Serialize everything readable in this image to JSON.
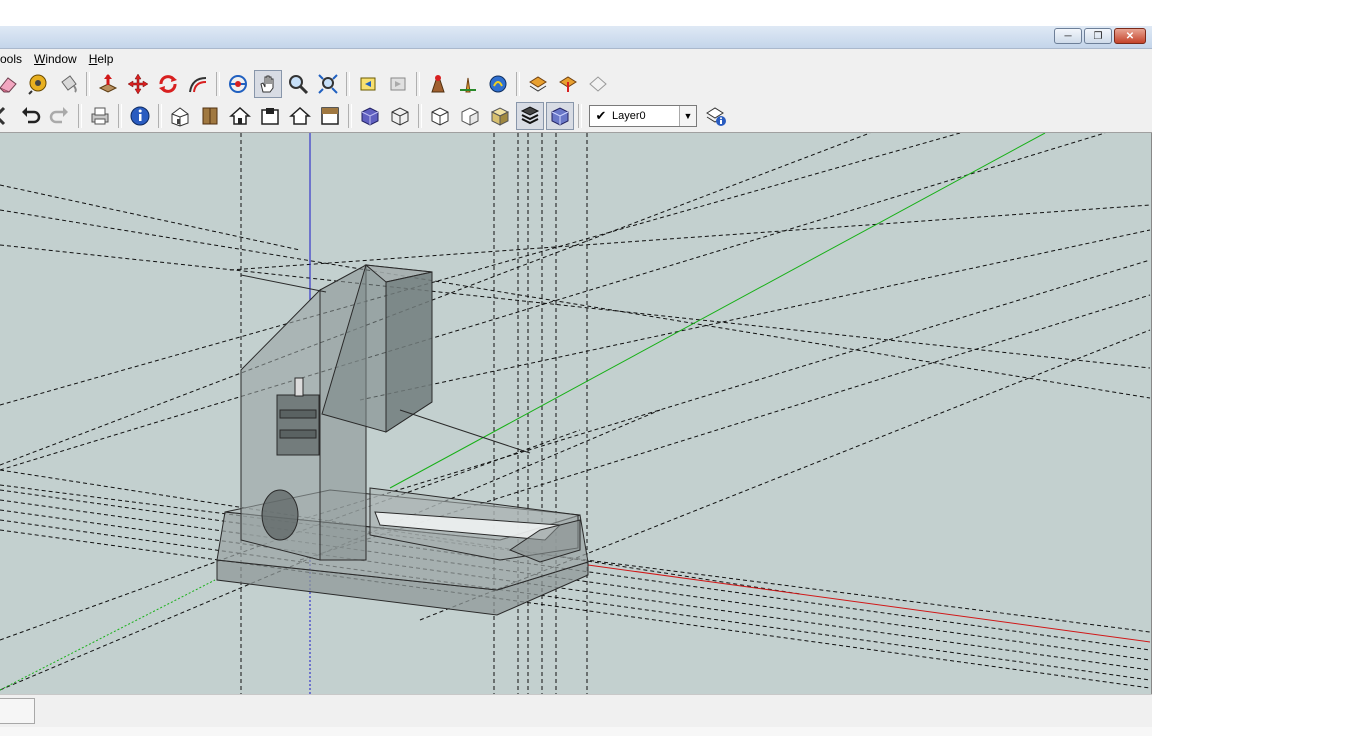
{
  "menu": {
    "items": [
      "Tools",
      "Window",
      "Help"
    ],
    "visible_text": [
      "ools",
      "Window",
      "Help"
    ],
    "mnemonics": [
      "T",
      "W",
      "H"
    ]
  },
  "window_controls": {
    "minimize": "minimize-icon",
    "restore": "restore-icon",
    "close": "close-icon"
  },
  "toolbar_row1": {
    "tools": [
      "eraser",
      "tape-measure",
      "paint-bucket",
      "push-pull",
      "move",
      "rotate",
      "follow-me",
      "orbit",
      "pan",
      "zoom",
      "zoom-extents",
      "previous-view",
      "next-view",
      "position-camera",
      "look-around",
      "walk",
      "section-plane",
      "section-display",
      "section-cut"
    ]
  },
  "toolbar_row2": {
    "tools": [
      "back",
      "undo",
      "redo",
      "print",
      "model-info",
      "iso-view",
      "top-view",
      "front-view",
      "right-view",
      "back-view",
      "left-view",
      "xray",
      "wireframe",
      "hidden-line",
      "shaded",
      "shaded-textures",
      "monochrome"
    ],
    "pressed": [
      "shaded-textures",
      "monochrome"
    ]
  },
  "layer": {
    "current": "Layer0",
    "checked": true
  },
  "colors": {
    "viewport_bg": "#c3d0cf",
    "axis_red": "#d01818",
    "axis_green": "#18b018",
    "axis_blue": "#1818c8"
  }
}
